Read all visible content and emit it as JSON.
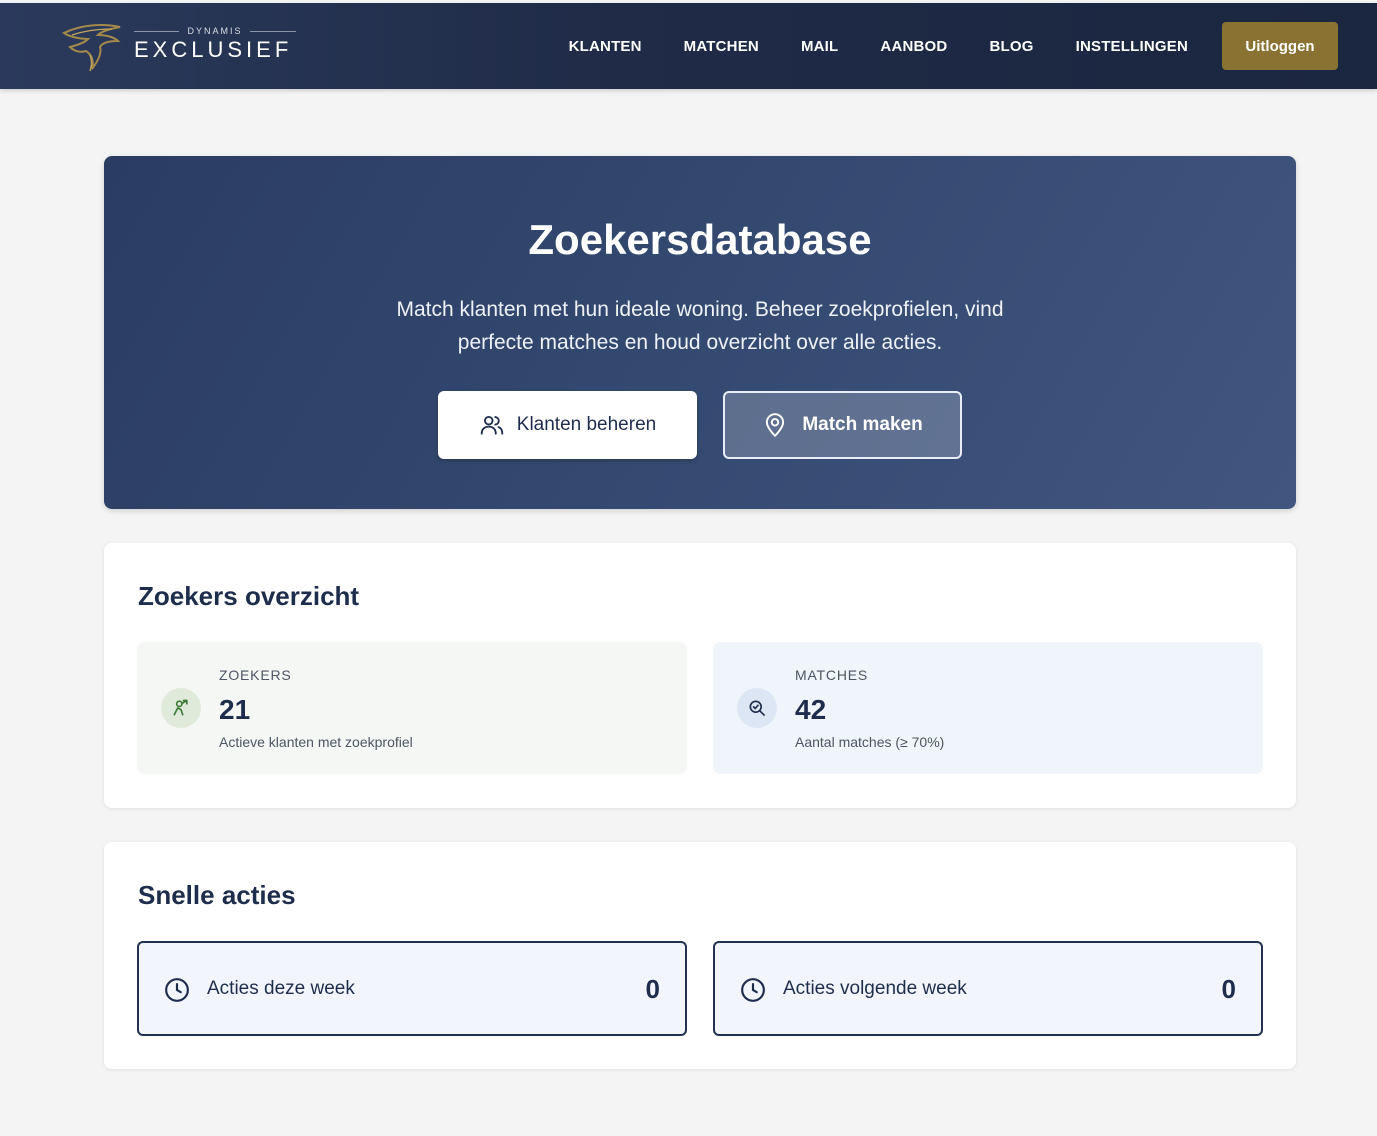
{
  "brand": {
    "top_text": "DYNAMIS",
    "name": "EXCLUSIEF",
    "logo_icon": "horse-head-logo",
    "accent_color": "#8a7233",
    "nav_color": "#1f2b47"
  },
  "nav": {
    "items": [
      {
        "label": "KLANTEN"
      },
      {
        "label": "MATCHEN"
      },
      {
        "label": "MAIL"
      },
      {
        "label": "AANBOD"
      },
      {
        "label": "BLOG"
      },
      {
        "label": "INSTELLINGEN"
      }
    ],
    "logout_label": "Uitloggen"
  },
  "hero": {
    "title": "Zoekersdatabase",
    "subtitle": "Match klanten met hun ideale woning. Beheer zoekprofielen, vind perfecte matches en houd overzicht over alle acties.",
    "primary_button": {
      "label": "Klanten beheren",
      "icon": "users-icon"
    },
    "secondary_button": {
      "label": "Match maken",
      "icon": "map-pin-icon"
    }
  },
  "overview": {
    "title": "Zoekers overzicht",
    "stats": [
      {
        "label": "ZOEKERS",
        "value": "21",
        "description": "Actieve klanten met zoekprofiel",
        "icon": "user-search-icon",
        "color": "#3f7a3a"
      },
      {
        "label": "MATCHES",
        "value": "42",
        "description": "Aantal matches (≥ 70%)",
        "icon": "search-check-icon",
        "color": "#1f2d4d"
      }
    ]
  },
  "quick_actions": {
    "title": "Snelle acties",
    "items": [
      {
        "label": "Acties deze week",
        "count": "0",
        "icon": "clock-icon"
      },
      {
        "label": "Acties volgende week",
        "count": "0",
        "icon": "clock-icon"
      }
    ]
  }
}
